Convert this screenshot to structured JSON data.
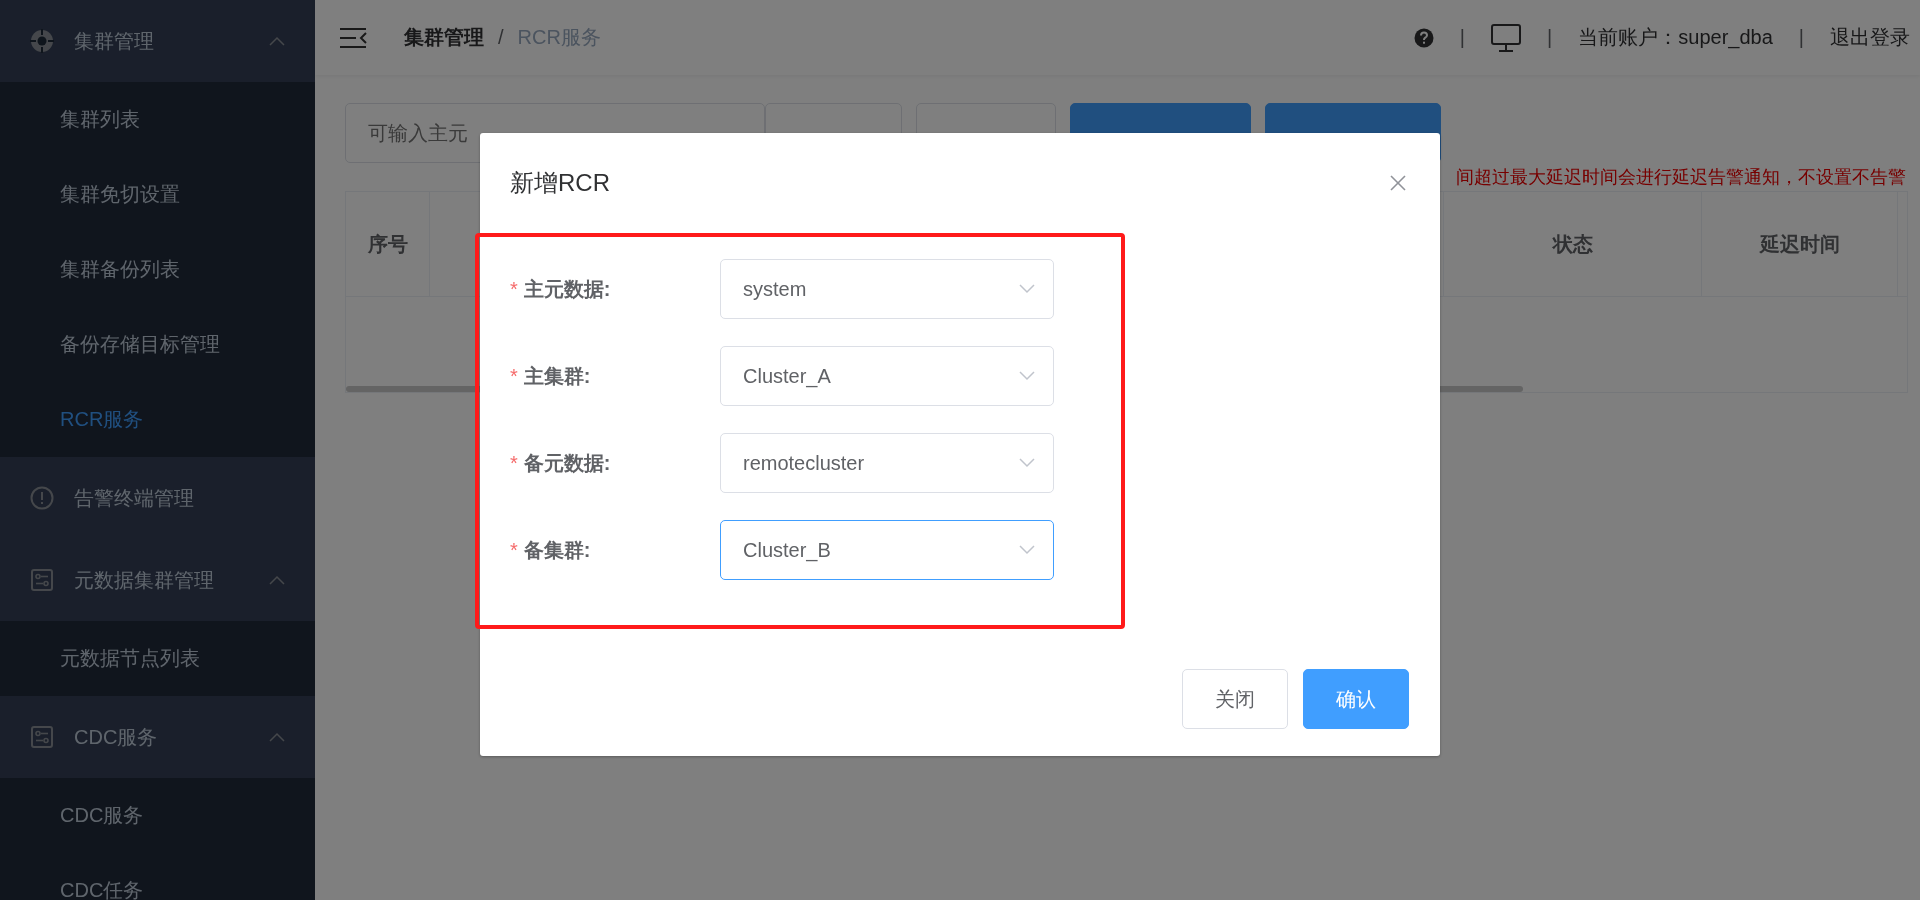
{
  "sidebar": {
    "groups": [
      {
        "label": "集群管理",
        "kind": "target",
        "expanded": true,
        "children": [
          {
            "label": "集群列表",
            "selected": false
          },
          {
            "label": "集群免切设置",
            "selected": false
          },
          {
            "label": "集群备份列表",
            "selected": false
          },
          {
            "label": "备份存储目标管理",
            "selected": false
          },
          {
            "label": "RCR服务",
            "selected": true
          }
        ]
      },
      {
        "label": "告警终端管理",
        "kind": "alert"
      },
      {
        "label": "元数据集群管理",
        "kind": "panel",
        "expanded": true,
        "children": [
          {
            "label": "元数据节点列表",
            "selected": false
          }
        ]
      },
      {
        "label": "CDC服务",
        "kind": "panel",
        "expanded": true,
        "children": [
          {
            "label": "CDC服务",
            "selected": false
          },
          {
            "label": "CDC任务",
            "selected": false
          }
        ]
      }
    ]
  },
  "header": {
    "breadcrumb": [
      "集群管理",
      "RCR服务"
    ],
    "separator": "/",
    "divider": "|",
    "account": "当前账户：super_dba",
    "logout": "退出登录"
  },
  "toolbar": {
    "search": {
      "placeholder": "可输入主元"
    },
    "buttons": [
      {
        "kind": "plain"
      },
      {
        "kind": "plain"
      },
      {
        "kind": "primary"
      },
      {
        "kind": "primary"
      }
    ]
  },
  "notice": "间超过最大延迟时间会进行延迟告警通知，不设置不告警",
  "table": {
    "columns": [
      "序号",
      "状态",
      "延迟时间"
    ]
  },
  "modal": {
    "title": "新增RCR",
    "required_mark": "*",
    "fields": [
      {
        "label": "主元数据:",
        "required": true,
        "value": "system",
        "focused": false
      },
      {
        "label": "主集群:",
        "required": true,
        "value": "Cluster_A",
        "focused": false
      },
      {
        "label": "备元数据:",
        "required": true,
        "value": "remotecluster",
        "focused": false
      },
      {
        "label": "备集群:",
        "required": true,
        "value": "Cluster_B",
        "focused": true
      }
    ],
    "buttons": [
      {
        "label": "关闭",
        "kind": "plain"
      },
      {
        "label": "确认",
        "kind": "primary"
      }
    ]
  }
}
